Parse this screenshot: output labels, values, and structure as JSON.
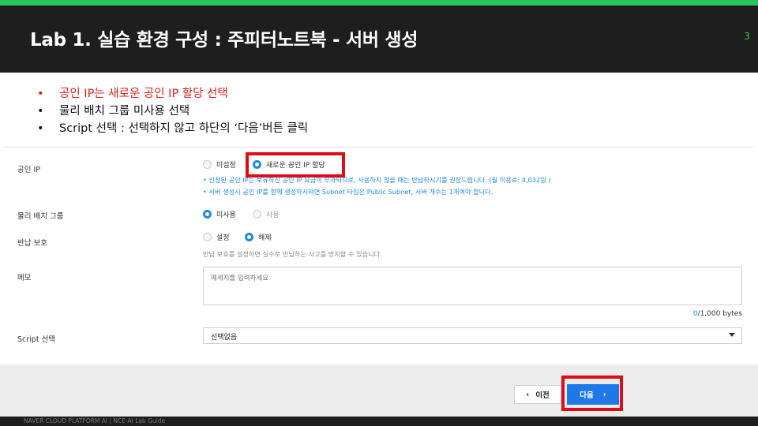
{
  "slide": {
    "title": "Lab 1. 실습 환경 구성 : 주피터노트북 - 서버 생성",
    "page_number": "3",
    "footer": "NAVER CLOUD PLATFORM AI  |  NCE-AI Lab Guide",
    "colors": {
      "accent": "#2bc75a",
      "header_bg": "#1e1e1e",
      "highlight": "#e00b17",
      "primary": "#1e78e6"
    }
  },
  "bullets": [
    {
      "marker": "•",
      "text": "공인 IP는 새로운 공인 IP 할당 선택"
    },
    {
      "marker": "•",
      "text": "물리 배치 그룹 미사용 선택"
    },
    {
      "marker": "•",
      "text": "Script 선택 : 선택하지 않고 하단의 ‘다음’버튼 클릭"
    }
  ],
  "form": {
    "public_ip": {
      "label": "공인 IP",
      "options": [
        "미설정",
        "새로운 공인 IP 할당"
      ],
      "selected": "새로운 공인 IP 할당",
      "notes": [
        "•  신청된 공인 IP는 보유하신 공인 IP 요금이 부과되므로, 사용하지 않을 때는 반납하시기를 권장드립니다. (월 이용료: 4,032원 )",
        "•  서버 생성시 공인 IP를 함께 생성하시려면 Subnet 타입은 Public Subnet, 서버 개수는 1개여야 합니다."
      ]
    },
    "placement_group": {
      "label": "물리 배치 그룹",
      "options": [
        "미사용",
        "사용"
      ],
      "selected": "미사용"
    },
    "return_protection": {
      "label": "반납 보호",
      "options": [
        "설정",
        "해제"
      ],
      "selected": "해제",
      "help": "반납 보호를 설정하면 실수로 반납하는 사고를 방지할 수 있습니다."
    },
    "memo": {
      "label": "메모",
      "placeholder": "메세지를 입력하세요",
      "value": "",
      "count_current": "0",
      "count_max": "/1,000 bytes"
    },
    "script": {
      "label": "Script 선택",
      "selected": "선택없음"
    }
  },
  "actions": {
    "prev_icon": "‹",
    "prev_label": "이전",
    "next_label": "다음",
    "next_icon": "›"
  }
}
